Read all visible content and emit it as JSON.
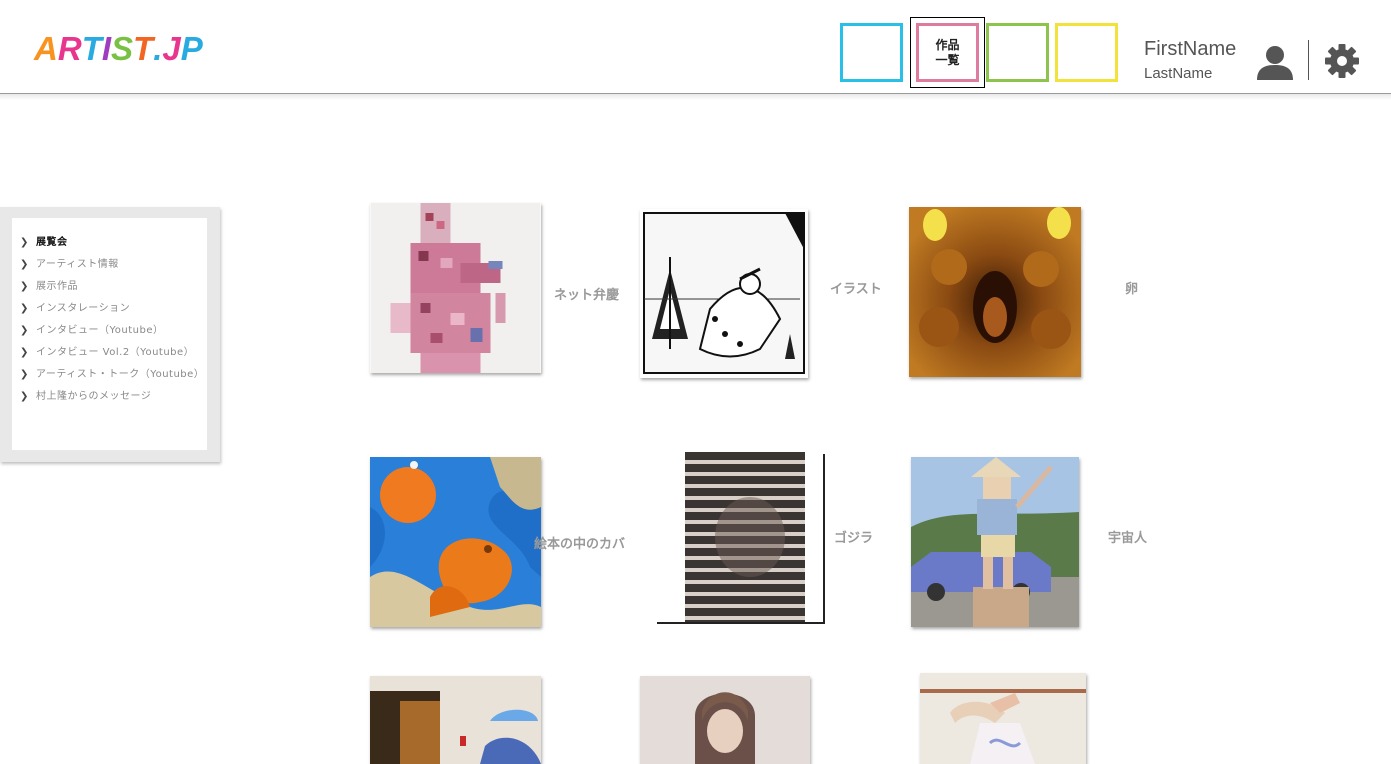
{
  "header": {
    "logo": [
      "A",
      "R",
      "T",
      "I",
      "S",
      "T",
      ".",
      "J",
      "P"
    ],
    "logo_colors": [
      "#f7931e",
      "#e8368f",
      "#29abe2",
      "#8e44ad",
      "#7ac143",
      "#f26522",
      "#29abe2",
      "#e8368f",
      "#29abe2"
    ],
    "nav_boxes": [
      {
        "label": "",
        "color": "#29c0e8"
      },
      {
        "label": "作品\n一覧",
        "color": "#e07ba0"
      },
      {
        "label": "",
        "color": "#8dc44e"
      },
      {
        "label": "",
        "color": "#f2e33a"
      }
    ],
    "user": {
      "first_name": "FirstName",
      "last_name": "LastName"
    }
  },
  "sidebar": {
    "items": [
      {
        "label": "展覧会",
        "active": true
      },
      {
        "label": "アーティスト情報",
        "active": false
      },
      {
        "label": "展示作品",
        "active": false
      },
      {
        "label": "インスタレーション",
        "active": false
      },
      {
        "label": "インタビュー（Youtube）",
        "active": false
      },
      {
        "label": "インタビュー Vol.2（Youtube）",
        "active": false
      },
      {
        "label": "アーティスト・トーク（Youtube）",
        "active": false
      },
      {
        "label": "村上隆からのメッセージ",
        "active": false
      }
    ]
  },
  "works": [
    {
      "title": "ネット弁慶"
    },
    {
      "title": "イラスト"
    },
    {
      "title": "卵"
    },
    {
      "title": "絵本の中のカバ"
    },
    {
      "title": "ゴジラ"
    },
    {
      "title": "宇宙人"
    },
    {
      "title": ""
    },
    {
      "title": ""
    },
    {
      "title": ""
    }
  ]
}
